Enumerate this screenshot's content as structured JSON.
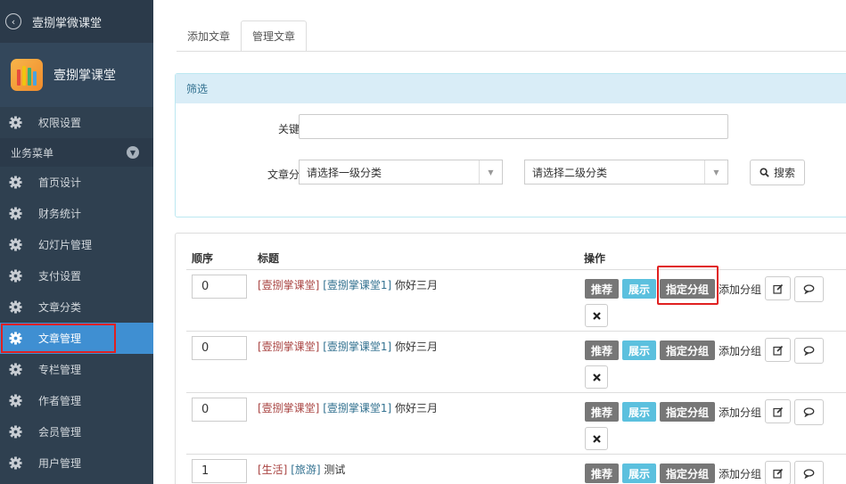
{
  "sidebar": {
    "back_title": "壹捌掌微课堂",
    "brand_name": "壹捌掌课堂",
    "permission_item": "权限设置",
    "group_label": "业务菜单",
    "items": [
      {
        "label": "首页设计"
      },
      {
        "label": "财务统计"
      },
      {
        "label": "幻灯片管理"
      },
      {
        "label": "支付设置"
      },
      {
        "label": "文章分类"
      },
      {
        "label": "文章管理"
      },
      {
        "label": "专栏管理"
      },
      {
        "label": "作者管理"
      },
      {
        "label": "会员管理"
      },
      {
        "label": "用户管理"
      }
    ],
    "active_item": "文章管理"
  },
  "tabs": [
    {
      "label": "添加文章"
    },
    {
      "label": "管理文章"
    }
  ],
  "filter": {
    "heading": "筛选",
    "keyword_label": "关键字",
    "keyword_value": "",
    "category_label": "文章分类",
    "category1_selected": "请选择一级分类",
    "category2_selected": "请选择二级分类",
    "search_label": "搜索"
  },
  "table": {
    "headers": {
      "order": "顺序",
      "title": "标题",
      "actions": "操作"
    },
    "rows": [
      {
        "order": "0",
        "tag1": "[壹捌掌课堂]",
        "tag2": "[壹捌掌课堂1]",
        "title": "你好三月"
      },
      {
        "order": "0",
        "tag1": "[壹捌掌课堂]",
        "tag2": "[壹捌掌课堂1]",
        "title": "你好三月"
      },
      {
        "order": "0",
        "tag1": "[壹捌掌课堂]",
        "tag2": "[壹捌掌课堂1]",
        "title": "你好三月"
      },
      {
        "order": "1",
        "tag1": "[生活]",
        "tag2": "[旅游]",
        "title": "测试"
      }
    ],
    "actions": {
      "recommend": "推荐",
      "show": "展示",
      "assign_group": "指定分组",
      "add_group": "添加分组"
    }
  },
  "colors": {
    "sidebar_bg": "#2f4050",
    "active_bg": "#3f8fd2",
    "highlight_border": "#e02020",
    "info": "#5bc0de",
    "label_gray": "#777777"
  }
}
